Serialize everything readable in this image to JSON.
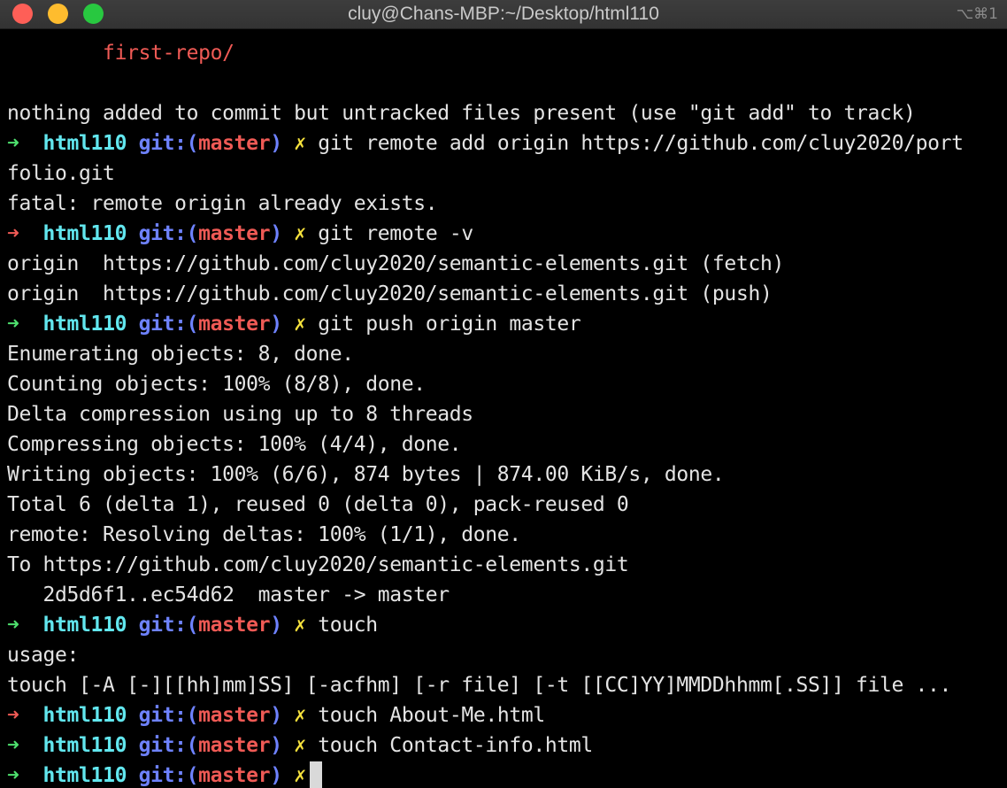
{
  "window": {
    "title": "cluy@Chans-MBP:~/Desktop/html110",
    "shortcut": "⌥⌘1"
  },
  "prompt": {
    "arrow": "➜",
    "dir": "html110",
    "git_open": "git:(",
    "branch": "master",
    "git_close": ")",
    "dirty_mark": "✗"
  },
  "lines": {
    "l0": "        first-repo/",
    "l1": "",
    "l2": "nothing added to commit but untracked files present (use \"git add\" to track)",
    "l3_cmd": "git remote add origin https://github.com/cluy2020/port",
    "l4": "folio.git",
    "l5": "fatal: remote origin already exists.",
    "l6_cmd": "git remote -v",
    "l7": "origin  https://github.com/cluy2020/semantic-elements.git (fetch)",
    "l8": "origin  https://github.com/cluy2020/semantic-elements.git (push)",
    "l9_cmd": "git push origin master",
    "l10": "Enumerating objects: 8, done.",
    "l11": "Counting objects: 100% (8/8), done.",
    "l12": "Delta compression using up to 8 threads",
    "l13": "Compressing objects: 100% (4/4), done.",
    "l14": "Writing objects: 100% (6/6), 874 bytes | 874.00 KiB/s, done.",
    "l15": "Total 6 (delta 1), reused 0 (delta 0), pack-reused 0",
    "l16": "remote: Resolving deltas: 100% (1/1), done.",
    "l17": "To https://github.com/cluy2020/semantic-elements.git",
    "l18": "   2d5d6f1..ec54d62  master -> master",
    "l19_cmd": "touch",
    "l20": "usage:",
    "l21": "touch [-A [-][[hh]mm]SS] [-acfhm] [-r file] [-t [[CC]YY]MMDDhhmm[.SS]] file ...",
    "l22_cmd": "touch About-Me.html",
    "l23_cmd": "touch Contact-info.html",
    "l24_cmd": ""
  },
  "colors": {
    "background": "#000000",
    "text": "#e4e4e4",
    "arrow_success": "#4ee06e",
    "arrow_error": "#ef5a55",
    "cwd": "#62e7ef",
    "git": "#6e82ff",
    "branch": "#ef5a55",
    "dirty": "#f4e03c"
  }
}
